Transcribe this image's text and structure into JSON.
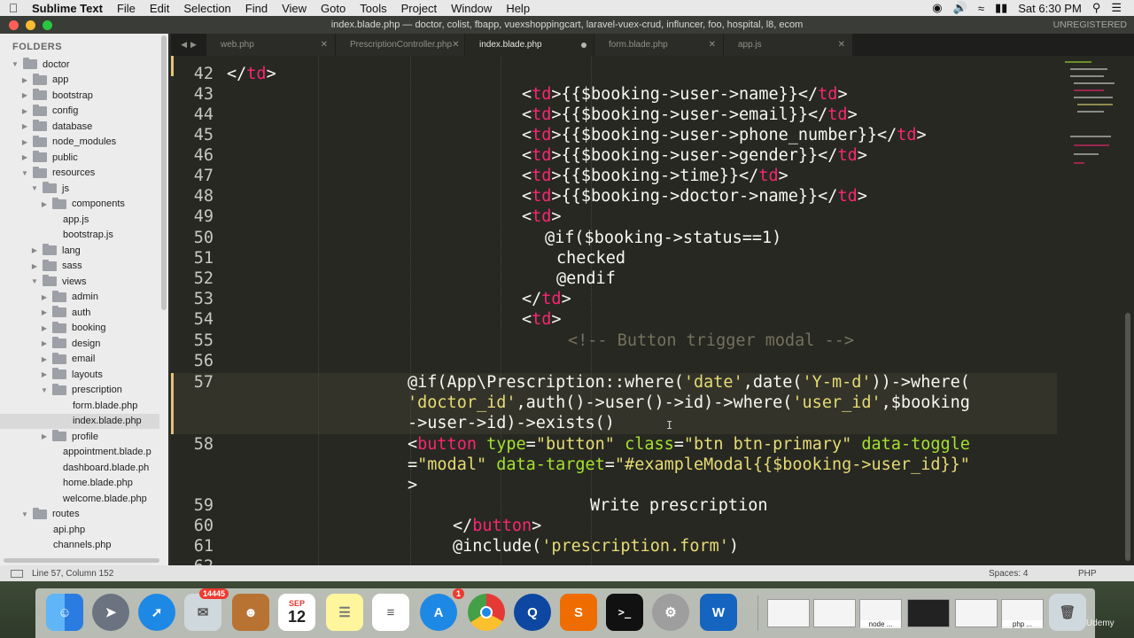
{
  "menubar": {
    "apple": "",
    "items": [
      "Sublime Text",
      "File",
      "Edit",
      "Selection",
      "Find",
      "View",
      "Goto",
      "Tools",
      "Project",
      "Window",
      "Help"
    ],
    "clock": "Sat 6:30 PM"
  },
  "window": {
    "title": "index.blade.php — doctor, colist, fbapp, vuexshoppingcart, laravel-vuex-crud, influncer, foo, hospital, l8, ecom",
    "unregistered": "UNREGISTERED"
  },
  "sidebar": {
    "title": "FOLDERS",
    "items": [
      {
        "label": "doctor",
        "depth": 0,
        "type": "folder",
        "open": true
      },
      {
        "label": "app",
        "depth": 1,
        "type": "folder"
      },
      {
        "label": "bootstrap",
        "depth": 1,
        "type": "folder"
      },
      {
        "label": "config",
        "depth": 1,
        "type": "folder"
      },
      {
        "label": "database",
        "depth": 1,
        "type": "folder"
      },
      {
        "label": "node_modules",
        "depth": 1,
        "type": "folder"
      },
      {
        "label": "public",
        "depth": 1,
        "type": "folder"
      },
      {
        "label": "resources",
        "depth": 1,
        "type": "folder",
        "open": true
      },
      {
        "label": "js",
        "depth": 2,
        "type": "folder",
        "open": true
      },
      {
        "label": "components",
        "depth": 3,
        "type": "folder"
      },
      {
        "label": "app.js",
        "depth": 3,
        "type": "file"
      },
      {
        "label": "bootstrap.js",
        "depth": 3,
        "type": "file"
      },
      {
        "label": "lang",
        "depth": 2,
        "type": "folder"
      },
      {
        "label": "sass",
        "depth": 2,
        "type": "folder"
      },
      {
        "label": "views",
        "depth": 2,
        "type": "folder",
        "open": true
      },
      {
        "label": "admin",
        "depth": 3,
        "type": "folder"
      },
      {
        "label": "auth",
        "depth": 3,
        "type": "folder"
      },
      {
        "label": "booking",
        "depth": 3,
        "type": "folder"
      },
      {
        "label": "design",
        "depth": 3,
        "type": "folder"
      },
      {
        "label": "email",
        "depth": 3,
        "type": "folder"
      },
      {
        "label": "layouts",
        "depth": 3,
        "type": "folder"
      },
      {
        "label": "prescription",
        "depth": 3,
        "type": "folder",
        "open": true
      },
      {
        "label": "form.blade.php",
        "depth": 4,
        "type": "file"
      },
      {
        "label": "index.blade.php",
        "depth": 4,
        "type": "file",
        "selected": true
      },
      {
        "label": "profile",
        "depth": 3,
        "type": "folder"
      },
      {
        "label": "appointment.blade.p",
        "depth": 3,
        "type": "file"
      },
      {
        "label": "dashboard.blade.ph",
        "depth": 3,
        "type": "file"
      },
      {
        "label": "home.blade.php",
        "depth": 3,
        "type": "file"
      },
      {
        "label": "welcome.blade.php",
        "depth": 3,
        "type": "file"
      },
      {
        "label": "routes",
        "depth": 1,
        "type": "folder",
        "open": true
      },
      {
        "label": "api.php",
        "depth": 2,
        "type": "file"
      },
      {
        "label": "channels.php",
        "depth": 2,
        "type": "file"
      }
    ]
  },
  "tabs": [
    {
      "label": "web.php",
      "active": false,
      "dirty": false
    },
    {
      "label": "PrescriptionController.php",
      "active": false,
      "dirty": false
    },
    {
      "label": "index.blade.php",
      "active": true,
      "dirty": true
    },
    {
      "label": "form.blade.php",
      "active": false,
      "dirty": false
    },
    {
      "label": "app.js",
      "active": false,
      "dirty": false
    }
  ],
  "editor": {
    "line_numbers": [
      "42",
      "43",
      "44",
      "45",
      "46",
      "47",
      "48",
      "49",
      "50",
      "51",
      "52",
      "53",
      "54",
      "55",
      "56",
      "57",
      "58",
      "59",
      "60",
      "61",
      "62"
    ],
    "current_line": "57"
  },
  "statusbar": {
    "position": "Line 57, Column 152",
    "spaces": "Spaces: 4",
    "syntax": "PHP"
  },
  "dock": {
    "mail_badge": "14445",
    "appstore_badge": "1",
    "calendar_month": "SEP",
    "calendar_day": "12",
    "thumb_labels": [
      "node ...",
      "php ..."
    ],
    "udemy": "Udemy"
  }
}
